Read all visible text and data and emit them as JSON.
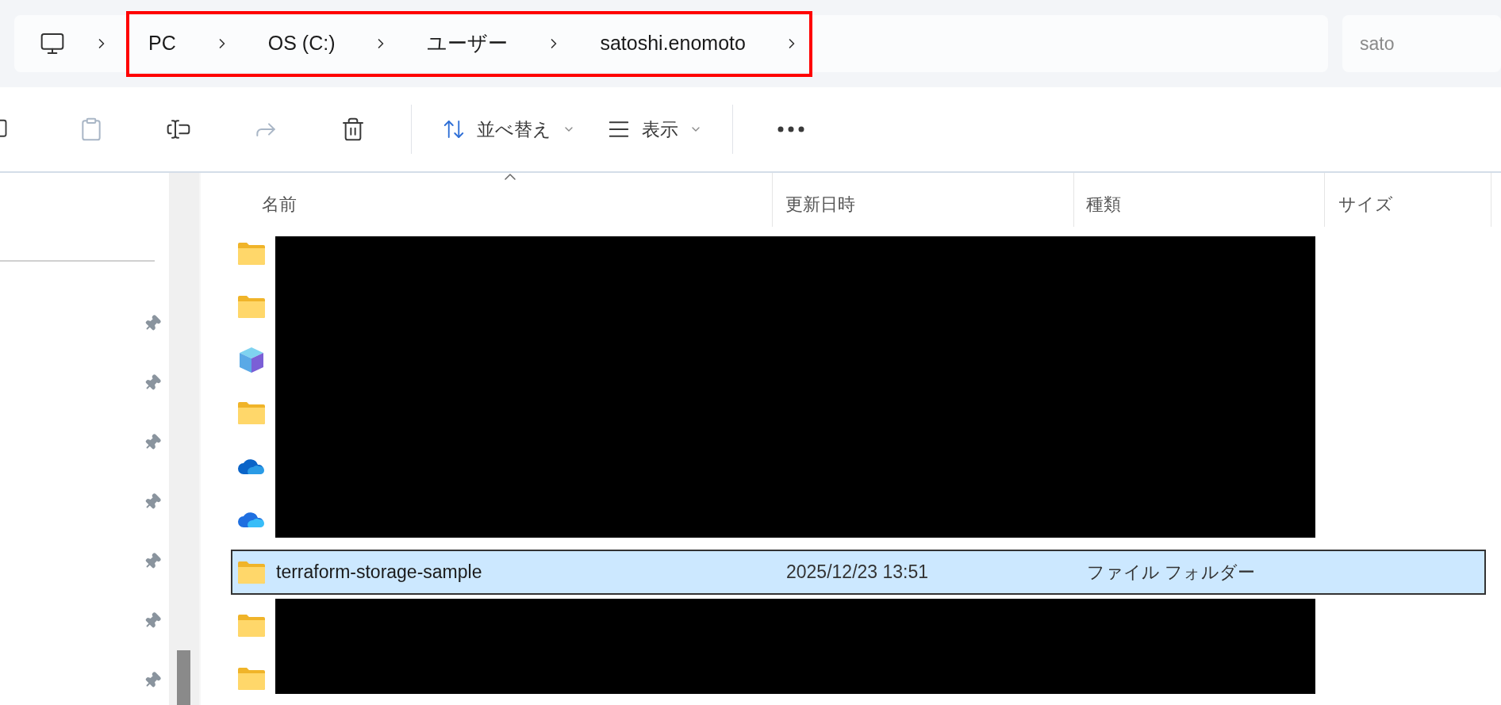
{
  "address_bar": {
    "crumbs": [
      {
        "label": "PC"
      },
      {
        "label": "OS (C:)"
      },
      {
        "label": "ユーザー"
      },
      {
        "label": "satoshi.enomoto"
      }
    ]
  },
  "search": {
    "placeholder": "sato"
  },
  "toolbar": {
    "groups": [
      {
        "buttons": [
          {
            "kind": "icon",
            "disabled": false
          },
          {
            "kind": "icon",
            "disabled": true
          },
          {
            "kind": "icon",
            "disabled": false
          },
          {
            "kind": "icon",
            "disabled": true
          },
          {
            "kind": "icon",
            "disabled": false
          }
        ]
      },
      {
        "buttons": [
          {
            "kind": "menu",
            "label": "並べ替え",
            "disabled": false
          },
          {
            "kind": "menu",
            "label": "表示",
            "disabled": false
          }
        ]
      },
      {
        "buttons": [
          {
            "kind": "icon",
            "disabled": false
          }
        ]
      }
    ]
  },
  "sidebar": {
    "items": [
      {
        "pinned": true
      },
      {
        "pinned": true
      },
      {
        "pinned": true
      },
      {
        "pinned": true
      },
      {
        "pinned": true
      },
      {
        "pinned": true
      },
      {
        "pinned": true
      }
    ]
  },
  "columns": [
    {
      "label": "名前",
      "sorted": true
    },
    {
      "label": "更新日時",
      "sorted": false
    },
    {
      "label": "種類",
      "sorted": false
    },
    {
      "label": "サイズ",
      "sorted": false
    }
  ],
  "rows": [
    {
      "kind": "folder",
      "selected": false
    },
    {
      "kind": "folder",
      "selected": false
    },
    {
      "kind": "cube",
      "selected": false
    },
    {
      "kind": "folder",
      "selected": false
    },
    {
      "kind": "cloud",
      "selected": false
    },
    {
      "kind": "cloud-bright",
      "selected": false
    },
    {
      "kind": "folder",
      "selected": true,
      "name": "terraform-storage-sample",
      "modified": "2025/12/23 13:51",
      "type": "ファイル フォルダー"
    },
    {
      "kind": "folder",
      "selected": false
    },
    {
      "kind": "folder",
      "selected": false
    }
  ]
}
